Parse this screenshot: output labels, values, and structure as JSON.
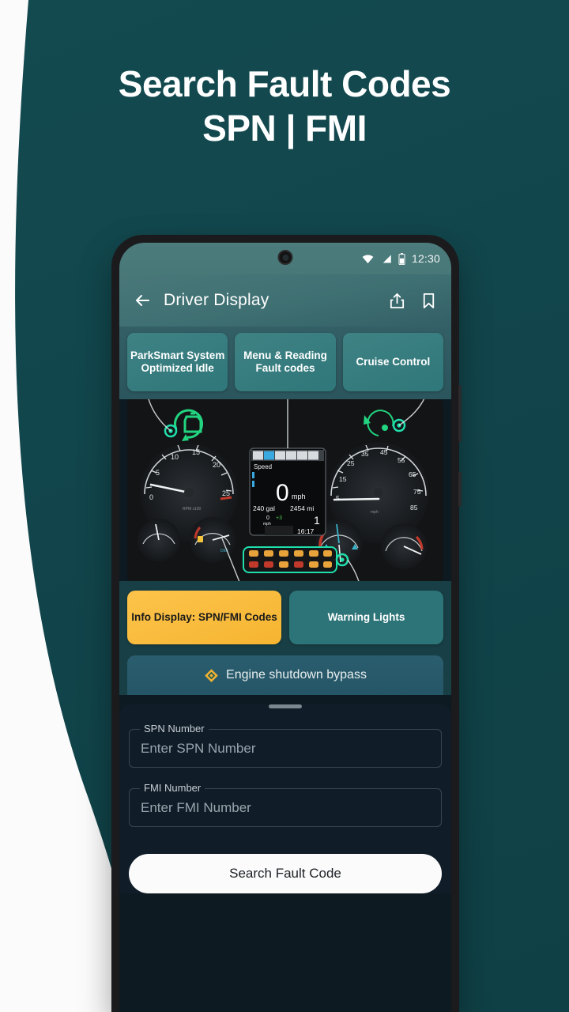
{
  "promo": {
    "title_line1": "Search Fault Codes",
    "title_line2": "SPN | FMI",
    "bg_color": "#11454b",
    "accent_color": "#2f777a"
  },
  "phone": {
    "statusbar": {
      "wifi_icon": "wifi-icon",
      "signal_icon": "signal-icon",
      "battery_icon": "battery-icon",
      "clock": "12:30"
    },
    "appbar": {
      "back_icon": "back-arrow-icon",
      "title": "Driver Display",
      "share_icon": "share-icon",
      "bookmark_icon": "bookmark-icon"
    },
    "callouts_top": [
      {
        "label": "ParkSmart System Optimized Idle",
        "style": "teal"
      },
      {
        "label": "Menu & Reading Fault codes",
        "style": "teal"
      },
      {
        "label": "Cruise Control",
        "style": "teal"
      }
    ],
    "callouts_bottom": [
      {
        "label": "Info Display: SPN/FMI Codes",
        "style": "amber"
      },
      {
        "label": "Warning Lights",
        "style": "teal-flat"
      }
    ],
    "dashboard": {
      "alt": "Truck instrument cluster photo",
      "center_display": {
        "header": "Speed",
        "speed_value": "0",
        "speed_unit": "mph",
        "fuel": "240 gal",
        "odometer": "2454 mi",
        "cruise_speed": "0",
        "cruise_unit": "mph",
        "cruise_offset": "+3",
        "gear": "1",
        "clock": "16:17"
      },
      "left_gauge": {
        "name": "tachometer",
        "ticks": [
          "0",
          "5",
          "10",
          "15",
          "20",
          "25"
        ],
        "unit": "RPM x100"
      },
      "right_gauge": {
        "name": "speedometer",
        "ticks": [
          "5",
          "15",
          "25",
          "35",
          "45",
          "55",
          "65",
          "75",
          "85"
        ],
        "unit": "mph"
      },
      "highlight_icons": [
        "engine-restart-icon",
        "cruise-control-icon"
      ],
      "warning_lights_count": 12
    },
    "bypass": {
      "icon": "warning-diamond-icon",
      "label": "Engine shutdown bypass"
    },
    "sheet": {
      "grabber": "drag-handle",
      "fields": [
        {
          "label": "SPN Number",
          "value": "",
          "placeholder": "Enter SPN Number"
        },
        {
          "label": "FMI Number",
          "value": "",
          "placeholder": "Enter FMI Number"
        }
      ],
      "submit_label": "Search Fault Code"
    }
  }
}
